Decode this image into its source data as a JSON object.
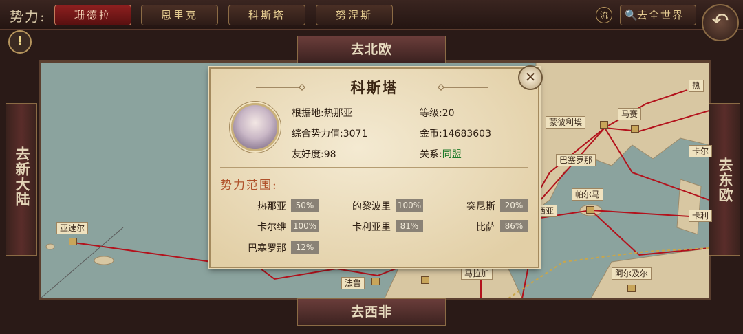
{
  "topbar": {
    "faction_label": "势力:",
    "tabs": [
      "珊德拉",
      "恩里克",
      "科斯塔",
      "努涅斯"
    ],
    "liu_label": "流",
    "world_button": "去全世界"
  },
  "nav": {
    "north": "去北欧",
    "south": "去西非",
    "west": "去新大陆",
    "east": "去东欧"
  },
  "map": {
    "cities": [
      "亚速尔",
      "蒙彼利埃",
      "马赛",
      "巴塞罗那",
      "帕尔马",
      "马拉加",
      "法鲁",
      "阿尔及尔",
      "热",
      "卡尔",
      "卡利",
      "西亚"
    ]
  },
  "panel": {
    "title": "科斯塔",
    "base_label": "根据地:",
    "base_value": "热那亚",
    "level_label": "等级:",
    "level_value": "20",
    "power_label": "综合势力值:",
    "power_value": "3071",
    "gold_label": "金币:",
    "gold_value": "14683603",
    "friendship_label": "友好度:",
    "friendship_value": "98",
    "relation_label": "关系:",
    "relation_value": "同盟",
    "scope_title": "势力范围:",
    "scope": [
      {
        "name": "热那亚",
        "pct": "50%"
      },
      {
        "name": "的黎波里",
        "pct": "100%"
      },
      {
        "name": "突尼斯",
        "pct": "20%"
      },
      {
        "name": "卡尔维",
        "pct": "100%"
      },
      {
        "name": "卡利亚里",
        "pct": "81%"
      },
      {
        "name": "比萨",
        "pct": "86%"
      },
      {
        "name": "巴塞罗那",
        "pct": "12%"
      }
    ]
  },
  "colors": {
    "active_tab": "#8d1f1f",
    "route_line": "#b3121c",
    "sea": "#8ba39e",
    "land": "#d8c7a2",
    "relation_green": "#1f7a2a"
  }
}
